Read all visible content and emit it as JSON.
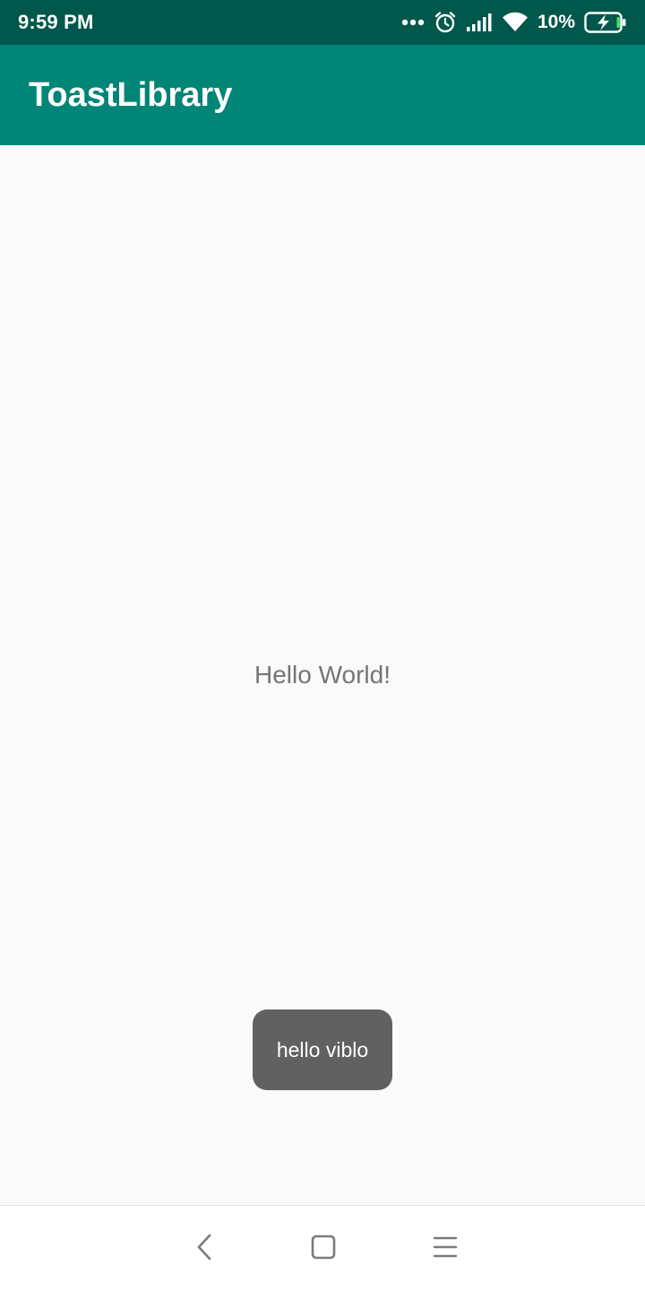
{
  "status_bar": {
    "time": "9:59 PM",
    "battery_percent": "10%",
    "battery_level": 0.1,
    "icons": [
      "more-dots-icon",
      "alarm-icon",
      "signal-icon",
      "wifi-icon",
      "battery-charging-icon"
    ]
  },
  "app_bar": {
    "title": "ToastLibrary"
  },
  "main": {
    "text": "Hello World!"
  },
  "toast": {
    "message": "hello viblo"
  },
  "nav_bar": {
    "icons": [
      "back-icon",
      "home-icon",
      "menu-icon"
    ]
  },
  "colors": {
    "status_bar": "#00574b",
    "app_bar": "#008577",
    "toast": "#616161",
    "battery_charge": "#4cd964"
  }
}
